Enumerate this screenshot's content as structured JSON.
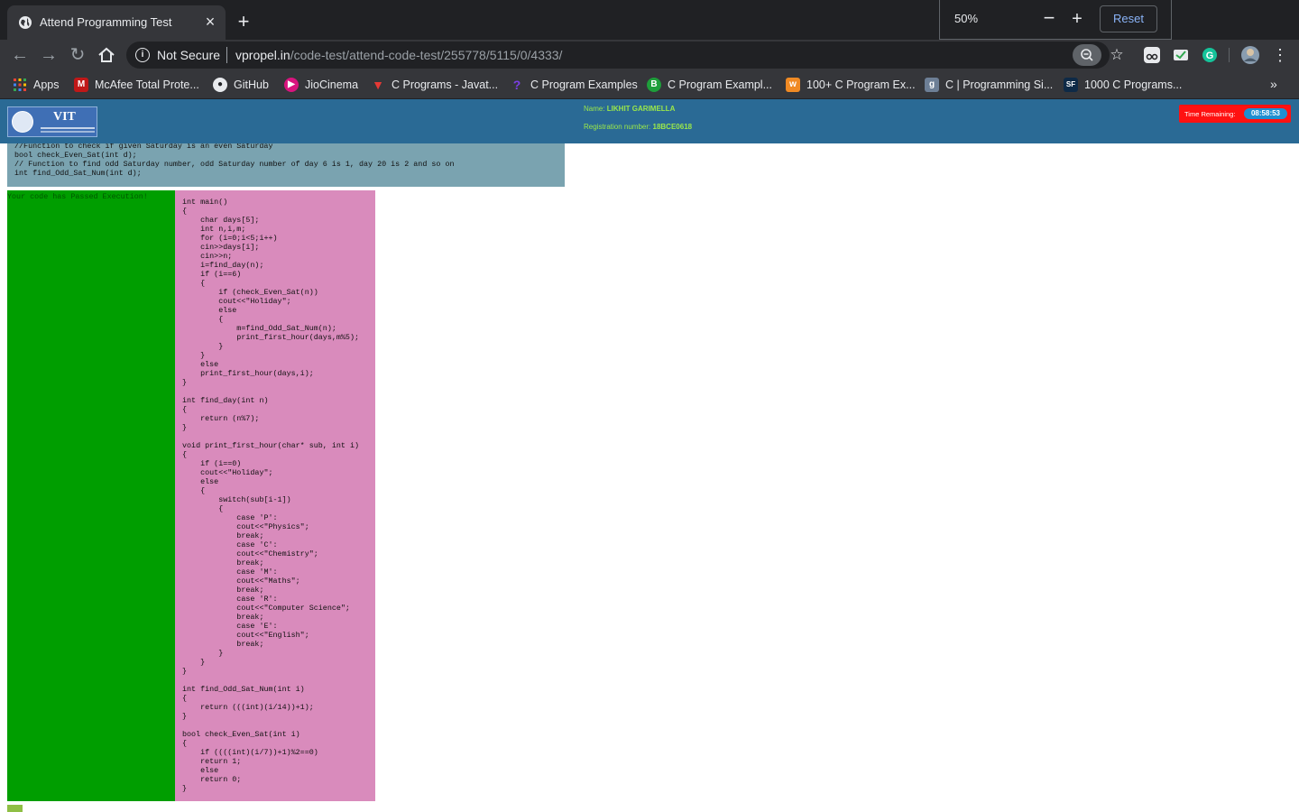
{
  "browser": {
    "tab_title": "Attend Programming Test",
    "tab_close": "×",
    "new_tab": "+",
    "zoom": {
      "level": "50%",
      "minus": "−",
      "plus": "+",
      "reset": "Reset"
    },
    "security_label": "Not Secure",
    "url_domain": "vpropel.in",
    "url_path": "/code-test/attend-code-test/255778/5115/0/4333/",
    "bookmarks": [
      {
        "label": "Apps",
        "icon": "apps-grid-icon"
      },
      {
        "label": "McAfee Total Prote...",
        "icon": "mcafee-icon"
      },
      {
        "label": "GitHub",
        "icon": "github-icon"
      },
      {
        "label": "JioCinema",
        "icon": "jiocinema-icon"
      },
      {
        "label": "C Programs - Javat...",
        "icon": "javatpoint-icon"
      },
      {
        "label": "C Program Examples",
        "icon": "programiz-icon"
      },
      {
        "label": "C Program Exampl...",
        "icon": "beginnersbook-icon"
      },
      {
        "label": "100+ C Program Ex...",
        "icon": "w3resource-icon"
      },
      {
        "label": "C | Programming Si...",
        "icon": "geeksforgeeks-icon"
      },
      {
        "label": "1000 C Programs...",
        "icon": "sanfoundry-icon"
      }
    ],
    "bookmarks_more": "»"
  },
  "header": {
    "name_label": "Name:",
    "name_value": "LIKHIT GARIMELLA",
    "reg_label": "Registration number:",
    "reg_value": "18BCE0618",
    "timer_label": "Time Remaining:",
    "timer_value": "08:58:53",
    "logo_text": "VIT"
  },
  "declarations": "//Function to check if given Saturday is an even Saturday\nbool check_Even_Sat(int d);\n// Function to find odd Saturday number, odd Saturday number of day 6 is 1, day 20 is 2 and so on\nint find_Odd_Sat_Num(int d);",
  "result_message": "Your code has Passed Execution!",
  "code": "int main()\n{\n    char days[5];\n    int n,i,m;\n    for (i=0;i<5;i++)\n    cin>>days[i];\n    cin>>n;\n    i=find_day(n);\n    if (i==6)\n    {\n        if (check_Even_Sat(n))\n        cout<<\"Holiday\";\n        else\n        {\n            m=find_Odd_Sat_Num(n);\n            print_first_hour(days,m%5);\n        }\n    }\n    else\n    print_first_hour(days,i);\n}\n\nint find_day(int n)\n{\n    return (n%7);\n}\n\nvoid print_first_hour(char* sub, int i)\n{\n    if (i==0)\n    cout<<\"Holiday\";\n    else\n    {\n        switch(sub[i-1])\n        {\n            case 'P':\n            cout<<\"Physics\";\n            break;\n            case 'C':\n            cout<<\"Chemistry\";\n            break;\n            case 'M':\n            cout<<\"Maths\";\n            break;\n            case 'R':\n            cout<<\"Computer Science\";\n            break;\n            case 'E':\n            cout<<\"English\";\n            break;\n        }\n    }\n}\n\nint find_Odd_Sat_Num(int i)\n{\n    return (((int)(i/14))+1);\n}\n\nbool check_Even_Sat(int i)\n{\n    if ((((int)(i/7))+1)%2==0)\n    return 1;\n    else\n    return 0;\n}",
  "colors": {
    "page_header": "#2a6a95",
    "result_panel": "#009e00",
    "code_panel": "#d98bbc",
    "declarations_panel": "#7aa3b0",
    "timer": "#ff1111"
  }
}
